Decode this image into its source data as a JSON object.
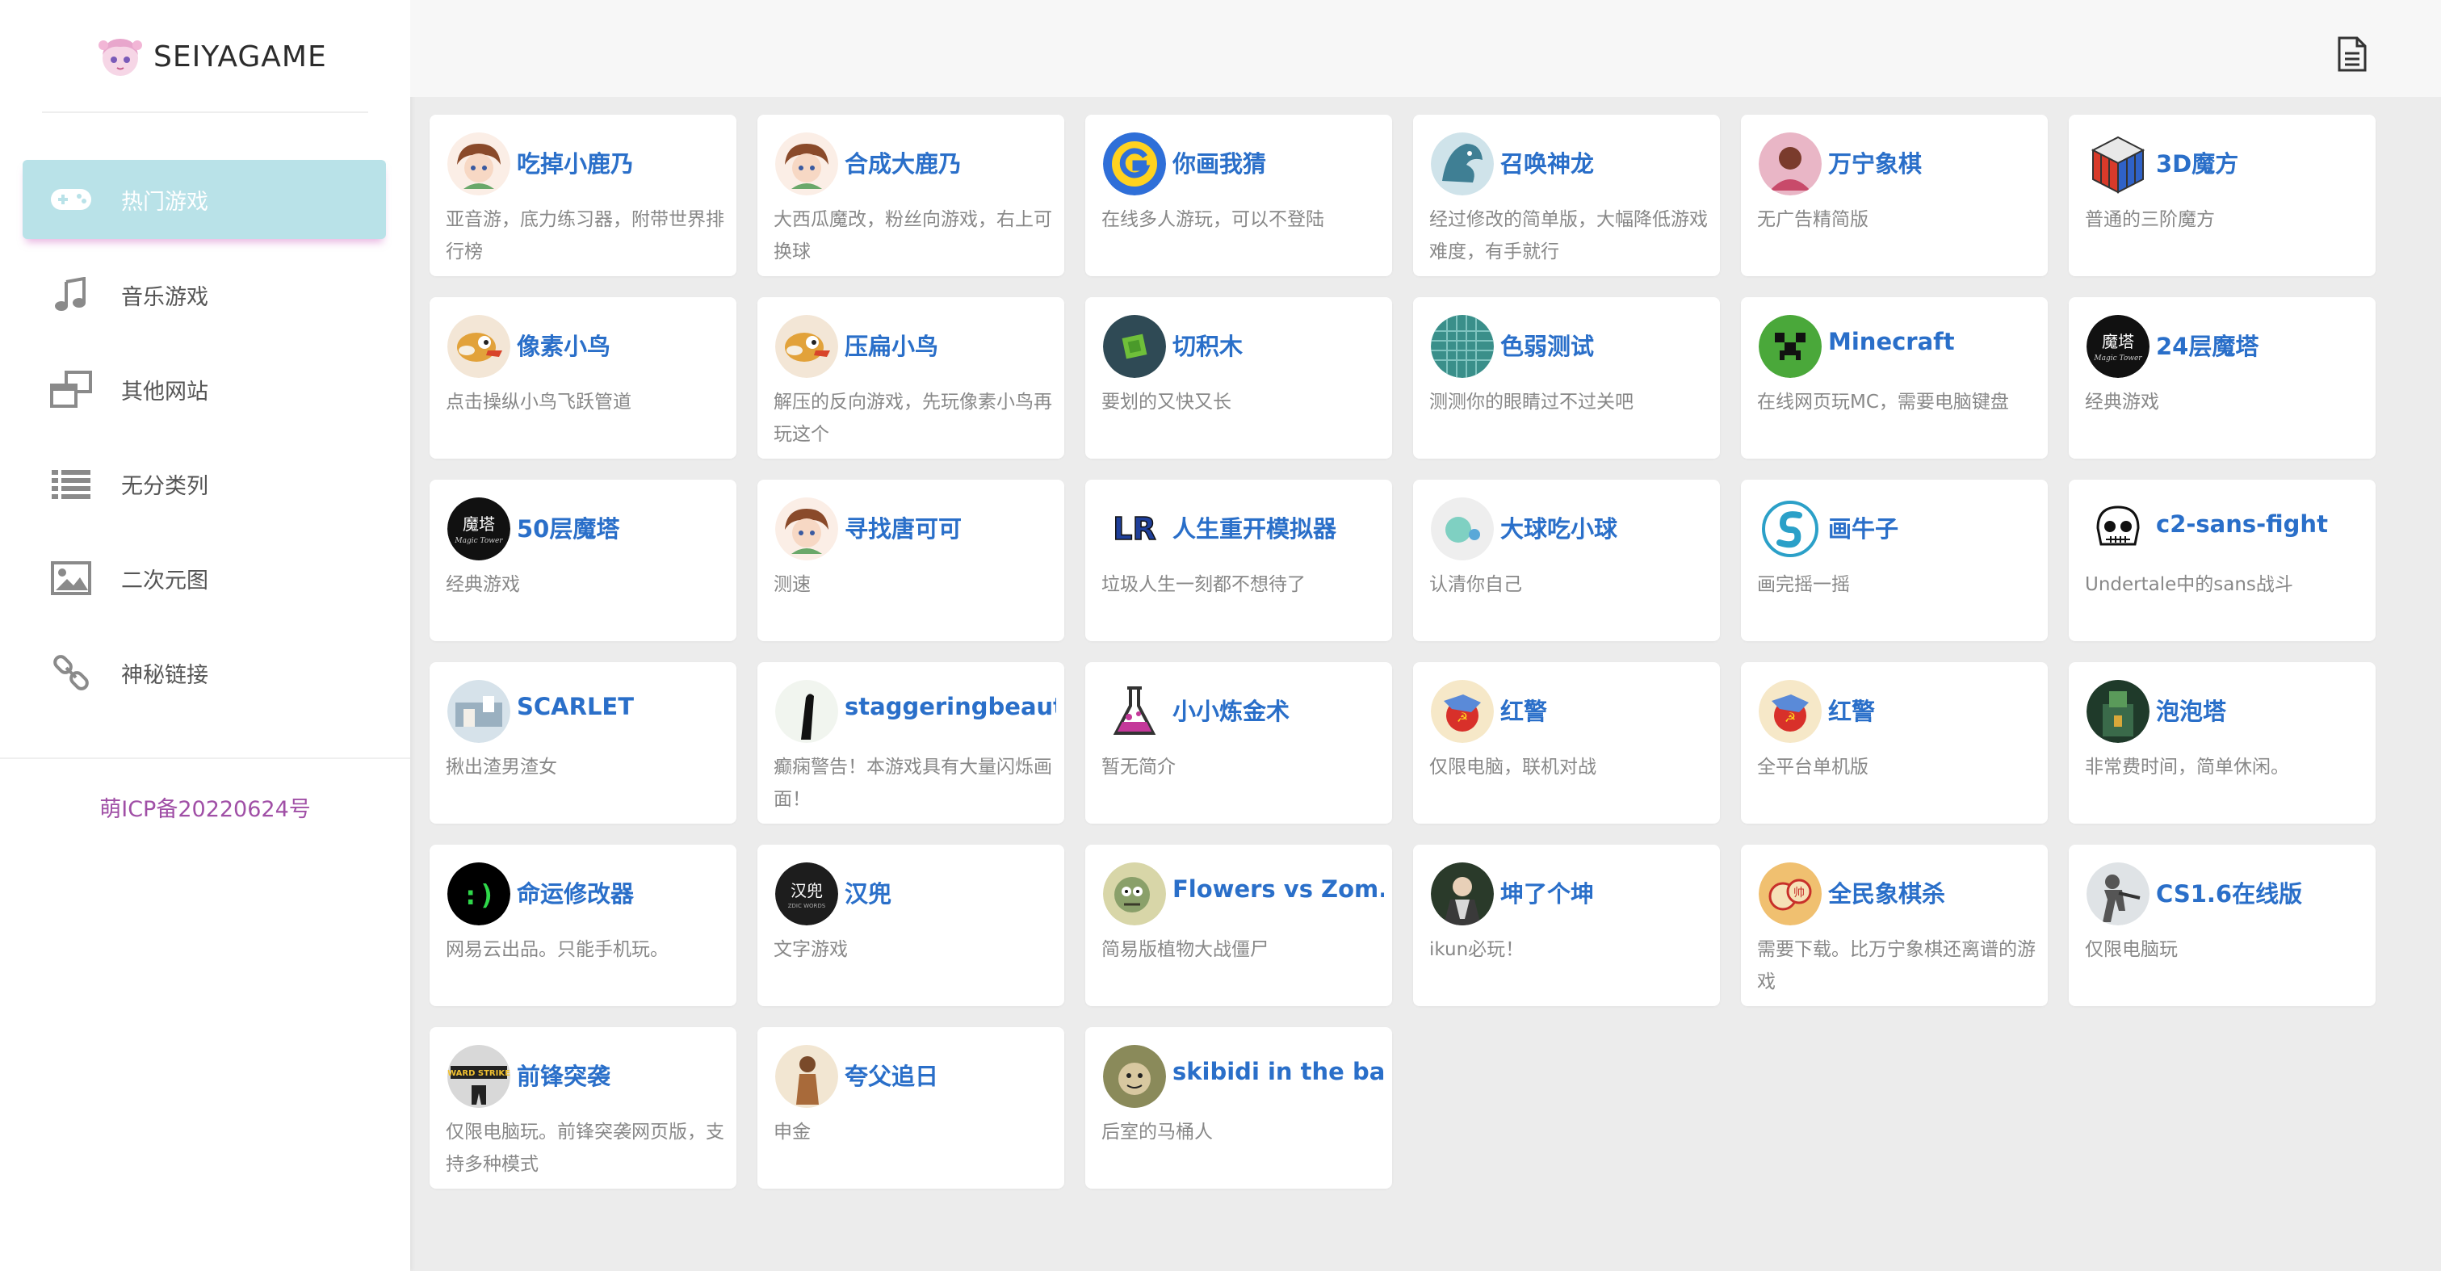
{
  "brand": {
    "name": "SEIYAGAME"
  },
  "nav": [
    {
      "label": "热门游戏",
      "icon": "gamepad-icon",
      "active": true
    },
    {
      "label": "音乐游戏",
      "icon": "music-note-icon"
    },
    {
      "label": "其他网站",
      "icon": "windows-icon"
    },
    {
      "label": "无分类列",
      "icon": "list-icon"
    },
    {
      "label": "二次元图",
      "icon": "image-icon"
    },
    {
      "label": "神秘链接",
      "icon": "link-icon"
    }
  ],
  "footer": {
    "icp": "萌ICP备20220624号"
  },
  "games": [
    {
      "title": "吃掉小鹿乃",
      "desc": "亚音游，底力练习器，附带世界排行榜",
      "icon": "anime-girl-icon"
    },
    {
      "title": "合成大鹿乃",
      "desc": "大西瓜魔改，粉丝向游戏，右上可换球",
      "icon": "anime-girl-icon"
    },
    {
      "title": "你画我猜",
      "desc": "在线多人游玩，可以不登陆",
      "icon": "g-logo-icon"
    },
    {
      "title": "召唤神龙",
      "desc": "经过修改的简单版，大幅降低游戏难度，有手就行",
      "icon": "dragon-icon"
    },
    {
      "title": "万宁象棋",
      "desc": "无广告精简版",
      "icon": "avatar-icon"
    },
    {
      "title": "3D魔方",
      "desc": "普通的三阶魔方",
      "icon": "rubiks-cube-icon"
    },
    {
      "title": "像素小鸟",
      "desc": "点击操纵小鸟飞跃管道",
      "icon": "flappy-bird-icon"
    },
    {
      "title": "压扁小鸟",
      "desc": "解压的反向游戏，先玩像素小鸟再玩这个",
      "icon": "flappy-bird-icon"
    },
    {
      "title": "切积木",
      "desc": "要划的又快又长",
      "icon": "block-icon"
    },
    {
      "title": "色弱测试",
      "desc": "测测你的眼睛过不过关吧",
      "icon": "grid-icon"
    },
    {
      "title": "Minecraft",
      "desc": "在线网页玩MC，需要电脑键盘",
      "icon": "creeper-icon"
    },
    {
      "title": "24层魔塔",
      "desc": "经典游戏",
      "icon": "magic-tower-icon"
    },
    {
      "title": "50层魔塔",
      "desc": "经典游戏",
      "icon": "magic-tower-icon"
    },
    {
      "title": "寻找唐可可",
      "desc": "测速",
      "icon": "anime-girl-icon"
    },
    {
      "title": "人生重开模拟器",
      "desc": "垃圾人生一刻都不想待了",
      "icon": "lr-logo-icon"
    },
    {
      "title": "大球吃小球",
      "desc": "认清你自己",
      "icon": "balls-icon"
    },
    {
      "title": "画牛子",
      "desc": "画完摇一摇",
      "icon": "s-logo-icon"
    },
    {
      "title": "c2-sans-fight",
      "desc": "Undertale中的sans战斗",
      "icon": "skull-icon"
    },
    {
      "title": "SCARLET",
      "desc": "揪出渣男渣女",
      "icon": "scene-icon"
    },
    {
      "title": "staggeringbeauty",
      "desc": "癫痫警告！本游戏具有大量闪烁画面！",
      "icon": "worm-icon"
    },
    {
      "title": "小小炼金术",
      "desc": "暂无简介",
      "icon": "flask-icon"
    },
    {
      "title": "红警",
      "desc": "仅限电脑，联机对战",
      "icon": "red-alert-icon"
    },
    {
      "title": "红警",
      "desc": "全平台单机版",
      "icon": "red-alert-icon"
    },
    {
      "title": "泡泡塔",
      "desc": "非常费时间，简单休闲。",
      "icon": "tower-icon"
    },
    {
      "title": "命运修改器",
      "desc": "网易云出品。只能手机玩。",
      "icon": "smiley-icon"
    },
    {
      "title": "汉兜",
      "desc": "文字游戏",
      "icon": "handou-icon"
    },
    {
      "title": "Flowers vs Zom...",
      "desc": "简易版植物大战僵尸",
      "icon": "zombie-icon"
    },
    {
      "title": "坤了个坤",
      "desc": "ikun必玩！",
      "icon": "character-icon"
    },
    {
      "title": "全民象棋杀",
      "desc": "需要下载。比万宁象棋还离谱的游戏",
      "icon": "chess-icon"
    },
    {
      "title": "CS1.6在线版",
      "desc": "仅限电脑玩",
      "icon": "soldier-icon"
    },
    {
      "title": "前锋突袭",
      "desc": "仅限电脑玩。前锋突袭网页版，支持多种模式",
      "icon": "strike-icon"
    },
    {
      "title": "夸父追日",
      "desc": "申金",
      "icon": "runner-icon"
    },
    {
      "title": "skibidi in the ba...",
      "desc": "后室的马桶人",
      "icon": "face-icon"
    }
  ]
}
